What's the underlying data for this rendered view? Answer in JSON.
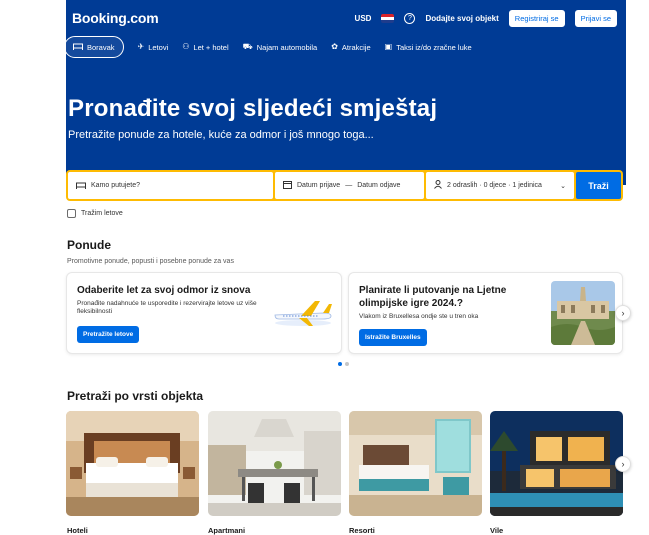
{
  "header": {
    "logo": "Booking.com",
    "currency": "USD",
    "list_property": "Dodajte svoj objekt",
    "register": "Registriraj se",
    "signin": "Prijavi se",
    "help_icon": "question-circle-icon",
    "flag_colors": [
      "#d8232a",
      "#ffffff",
      "#1f3c8c"
    ]
  },
  "nav": {
    "tabs": [
      {
        "label": "Boravak",
        "icon": "bed-icon",
        "active": true
      },
      {
        "label": "Letovi",
        "icon": "plane-icon",
        "active": false
      },
      {
        "label": "Let + hotel",
        "icon": "plane-hotel-icon",
        "active": false
      },
      {
        "label": "Najam automobila",
        "icon": "car-icon",
        "active": false
      },
      {
        "label": "Atrakcije",
        "icon": "attractions-icon",
        "active": false
      },
      {
        "label": "Taksi iz/do zračne luke",
        "icon": "taxi-icon",
        "active": false
      }
    ]
  },
  "hero": {
    "title": "Pronađite svoj sljedeći smještaj",
    "subtitle": "Pretražite ponude za hotele, kuće za odmor i još mnogo toga..."
  },
  "search": {
    "destination_placeholder": "Kamo putujete?",
    "checkin": "Datum prijave",
    "dash": "—",
    "checkout": "Datum odjave",
    "guests": "2 odraslih · 0 djece · 1 jedinica",
    "search_button": "Traži",
    "flights_checkbox": "Tražim letove"
  },
  "offers": {
    "heading": "Ponude",
    "subheading": "Promotivne ponude, popusti i posebne ponude za vas",
    "cards": [
      {
        "title": "Odaberite let za svoj odmor iz snova",
        "desc": "Pronađite nadahnuće te usporedite i rezervirajte letove uz više fleksibilnosti",
        "button": "Pretražite letove"
      },
      {
        "title": "Planirate li putovanje na Ljetne olimpijske igre 2024.?",
        "desc": "Vlakom iz Bruxellesa ondje ste u tren oka",
        "button": "Istražite Bruxelles"
      }
    ]
  },
  "property_types": {
    "heading": "Pretraži po vrsti objekta",
    "items": [
      {
        "label": "Hoteli"
      },
      {
        "label": "Apartmani"
      },
      {
        "label": "Resorti"
      },
      {
        "label": "Vile"
      }
    ]
  },
  "colors": {
    "brand_blue": "#003b95",
    "action_blue": "#006ce4",
    "search_yellow": "#febb02"
  }
}
